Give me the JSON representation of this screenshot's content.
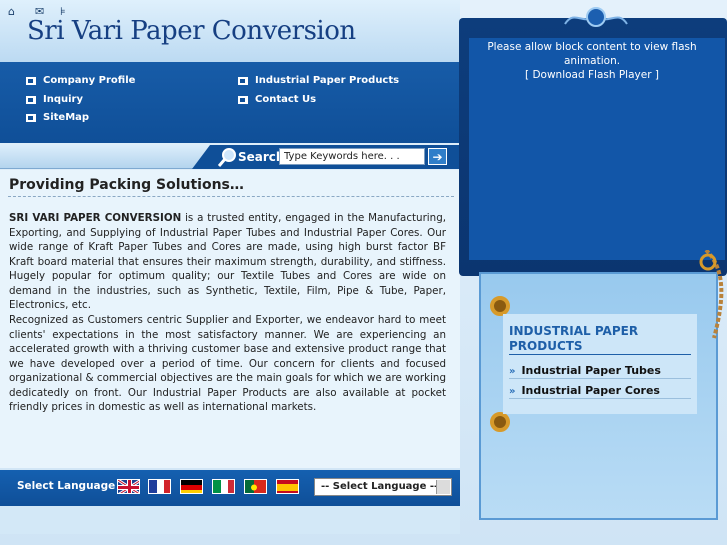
{
  "header": {
    "site_title": "Sri Vari Paper Conversion",
    "nav": {
      "company_profile": "Company Profile",
      "industrial_paper_products": "Industrial Paper Products",
      "inquiry": "Inquiry",
      "contact_us": "Contact Us",
      "sitemap": "SiteMap"
    }
  },
  "toolbar": {
    "icons": [
      "home-icon",
      "mail-icon",
      "sitemap-icon"
    ],
    "search_label": "Search",
    "search_value": "Type Keywords here. . ."
  },
  "main": {
    "heading": "Providing Packing Solutions…",
    "para1_lead": "SRI VARI PAPER CONVERSION",
    "para1_rest": " is a trusted entity, engaged in the Manufacturing, Exporting, and Supplying of Industrial Paper Tubes and Industrial Paper Cores. Our wide range of Kraft Paper Tubes and Cores are made, using high burst factor BF Kraft board material that ensures their maximum strength, durability, and stiffness. Hugely popular for optimum quality; our Textile Tubes and Cores are wide on demand in the industries, such as Synthetic, Textile, Film, Pipe & Tube, Paper, Electronics, etc.",
    "para2": "Recognized as Customers centric Supplier and Exporter, we endeavor hard to meet clients' expectations in the most satisfactory manner. We are experiencing an accelerated growth with a thriving customer base and extensive product range that we have developed over a period of time. Our concern for clients and focused organizational & commercial objectives are the main goals for which we are working dedicatedly on front. Our Industrial Paper Products are also available at pocket friendly prices in domestic as well as international markets."
  },
  "language": {
    "label": "Select Language :",
    "flags": [
      "uk-flag",
      "france-flag",
      "germany-flag",
      "italy-flag",
      "portugal-flag",
      "spain-flag"
    ],
    "select_value": "-- Select Language --"
  },
  "flash": {
    "message": "Please allow block content to view flash animation.",
    "download_link": "[ Download Flash Player ]"
  },
  "sidebar": {
    "heading": "INDUSTRIAL PAPER PRODUCTS",
    "items": [
      "Industrial Paper Tubes",
      "Industrial Paper Cores"
    ]
  },
  "colors": {
    "nav_blue": "#0f4f98",
    "title_blue": "#163f82",
    "accent": "#1e5fa8",
    "ring_gold": "#d79a2a"
  }
}
